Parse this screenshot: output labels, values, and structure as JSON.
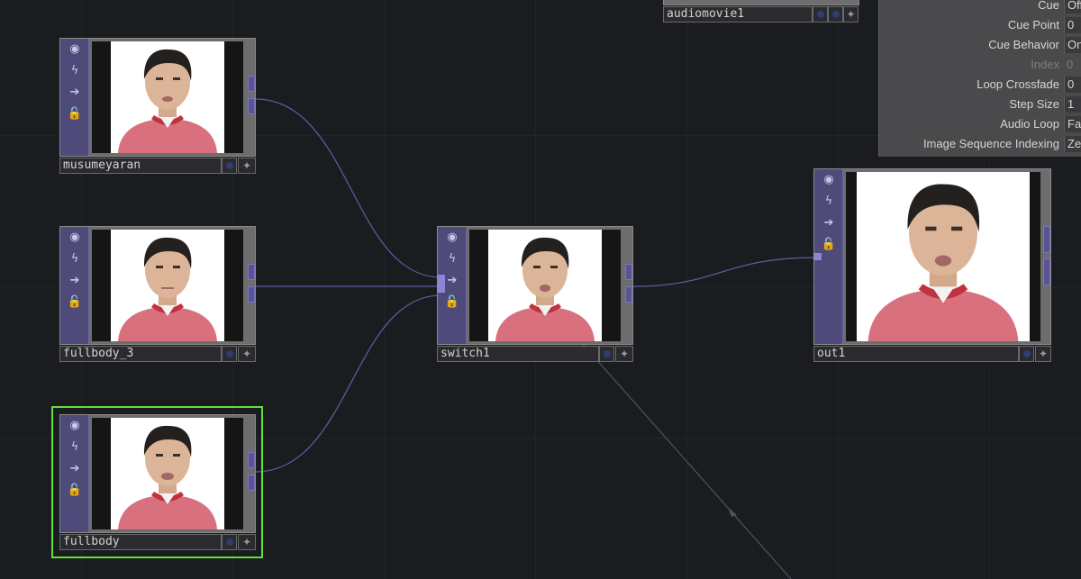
{
  "network": {
    "nodes": [
      {
        "id": "musumeyaran",
        "name": "musumeyaran",
        "selected": false
      },
      {
        "id": "fullbody_3",
        "name": "fullbody_3",
        "selected": false
      },
      {
        "id": "fullbody",
        "name": "fullbody",
        "selected": true
      },
      {
        "id": "switch1",
        "name": "switch1",
        "selected": false
      },
      {
        "id": "out1",
        "name": "out1",
        "selected": false
      },
      {
        "id": "audiomovie1",
        "name": "audiomovie1",
        "selected": false
      }
    ]
  },
  "params": {
    "rows": [
      {
        "label": "Cue",
        "value": "Off",
        "disabled": false
      },
      {
        "label": "Cue Point",
        "value": "0",
        "disabled": false
      },
      {
        "label": "Cue Behavior",
        "value": "On",
        "disabled": false
      },
      {
        "label": "Index",
        "value": "0",
        "disabled": true
      },
      {
        "label": "Loop Crossfade",
        "value": "0",
        "disabled": false
      },
      {
        "label": "Step Size",
        "value": "1",
        "disabled": false
      },
      {
        "label": "Audio Loop",
        "value": "Fade",
        "disabled": false
      },
      {
        "label": "Image Sequence Indexing",
        "value": "Zero",
        "disabled": false
      }
    ]
  },
  "colors": {
    "background": "#1b1c20",
    "rail": "#4e4a79",
    "selected": "#5fe03a",
    "wire": "#5d5a99",
    "link": "#4a5266"
  },
  "icons": {
    "rail": [
      "viewer-toggle-icon",
      "cook-icon",
      "bypass-icon",
      "lock-icon"
    ],
    "namebar": [
      "display-flag-icon",
      "pin-icon"
    ]
  }
}
